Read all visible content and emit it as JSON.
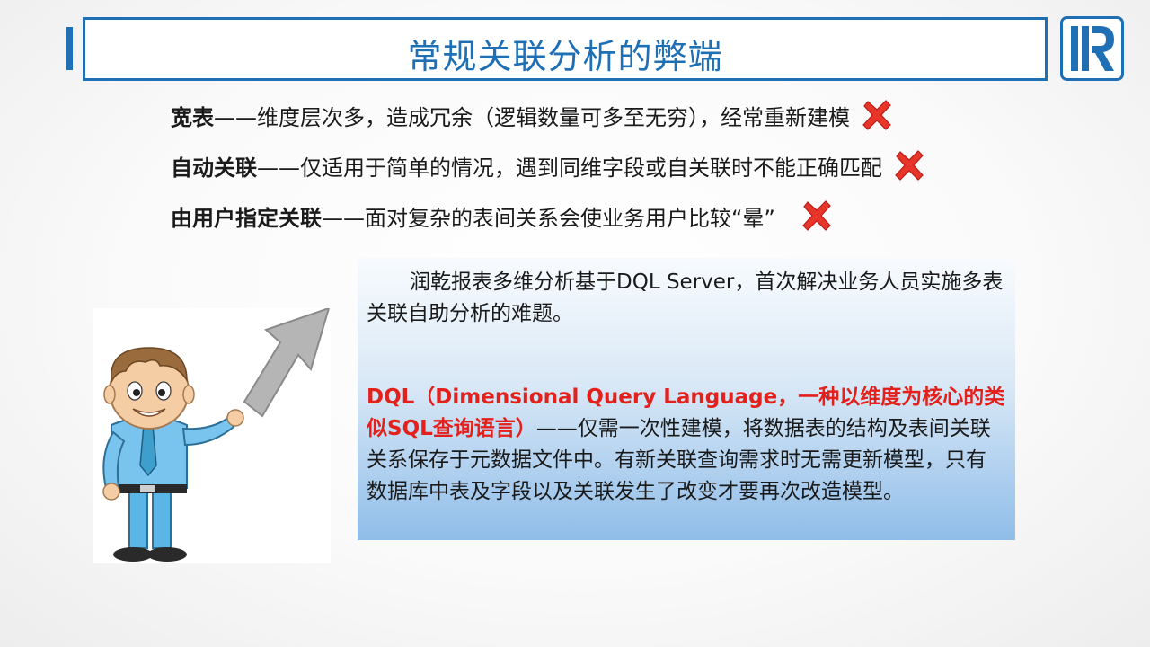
{
  "title": "常规关联分析的弊端",
  "rows": [
    {
      "term": "宽表",
      "desc": "——维度层次多，造成冗余（逻辑数量可多至无穷），经常重新建模",
      "mark": "red-x-icon"
    },
    {
      "term": "自动关联",
      "desc": "——仅适用于简单的情况，遇到同维字段或自关联时不能正确匹配",
      "mark": "red-x-icon"
    },
    {
      "term": "由用户指定关联",
      "desc": "——面对复杂的表间关系会使业务用户比较“晕”",
      "mark": "red-x-icon"
    }
  ],
  "info": {
    "para1": "润乾报表多维分析基于DQL Server，首次解决业务人员实施多表关联自助分析的难题。",
    "dql_highlight": "DQL（Dimensional Query Language，一种以维度为核心的类似SQL查询语言）",
    "dql_rest": "——仅需一次性建模，将数据表的结构及表间关联关系保存于元数据文件中。有新关联查询需求时无需更新模型，只有数据库中表及字段以及关联发生了改变才要再次改造模型。"
  },
  "colors": {
    "accent": "#1F6FB5",
    "highlight_red": "#E3201B",
    "x_mark": "#E8352A"
  }
}
